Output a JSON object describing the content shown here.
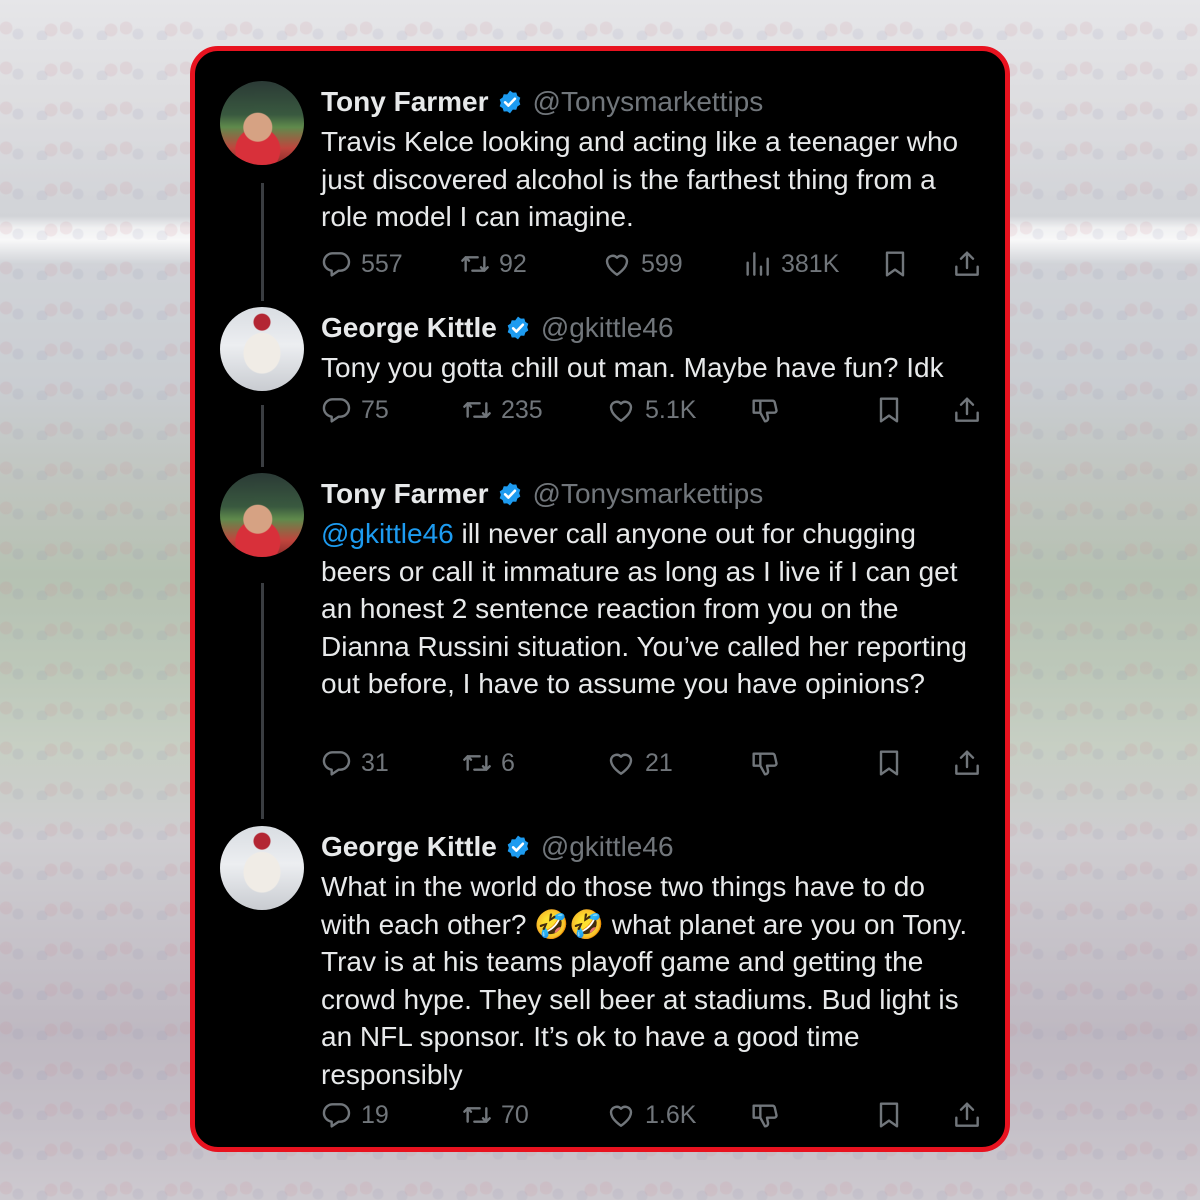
{
  "thread": {
    "tweets": [
      {
        "author": "Tony Farmer",
        "handle": "@Tonysmarkettips",
        "avatar_icon": "profile-photo-icon",
        "text": "Travis Kelce looking and acting like a teenager who just discovered alcohol is the farthest thing from a role model I can imagine.",
        "replies": "557",
        "reposts": "92",
        "likes": "599",
        "views": "381K"
      },
      {
        "author": "George Kittle",
        "handle": "@gkittle46",
        "avatar_icon": "profile-photo-icon",
        "text": "Tony you gotta chill out man. Maybe have fun? Idk",
        "replies": "75",
        "reposts": "235",
        "likes": "5.1K"
      },
      {
        "author": "Tony Farmer",
        "handle": "@Tonysmarkettips",
        "avatar_icon": "profile-photo-icon",
        "mention": "@gkittle46",
        "text": " ill never call anyone out for chugging beers or call it immature as long as I live if I can get an honest 2 sentence reaction from you on the Dianna Russini situation. You’ve called her reporting out before, I have to assume you have opinions?",
        "replies": "31",
        "reposts": "6",
        "likes": "21"
      },
      {
        "author": "George Kittle",
        "handle": "@gkittle46",
        "avatar_icon": "profile-photo-icon",
        "text": "What in the world do those two things have to do with each other? 🤣🤣 what planet are you on Tony. Trav is at his teams playoff game and getting the crowd hype. They sell beer at stadiums. Bud light is an NFL sponsor. It’s ok to have a good time responsibly",
        "replies": "19",
        "reposts": "70",
        "likes": "1.6K"
      }
    ]
  },
  "colors": {
    "frame_border": "#e8121f",
    "card_bg": "#000000",
    "text_primary": "#e7e9ea",
    "text_secondary": "#71767b",
    "link_blue": "#1d9bf0",
    "verified_blue": "#1d9bf0"
  }
}
